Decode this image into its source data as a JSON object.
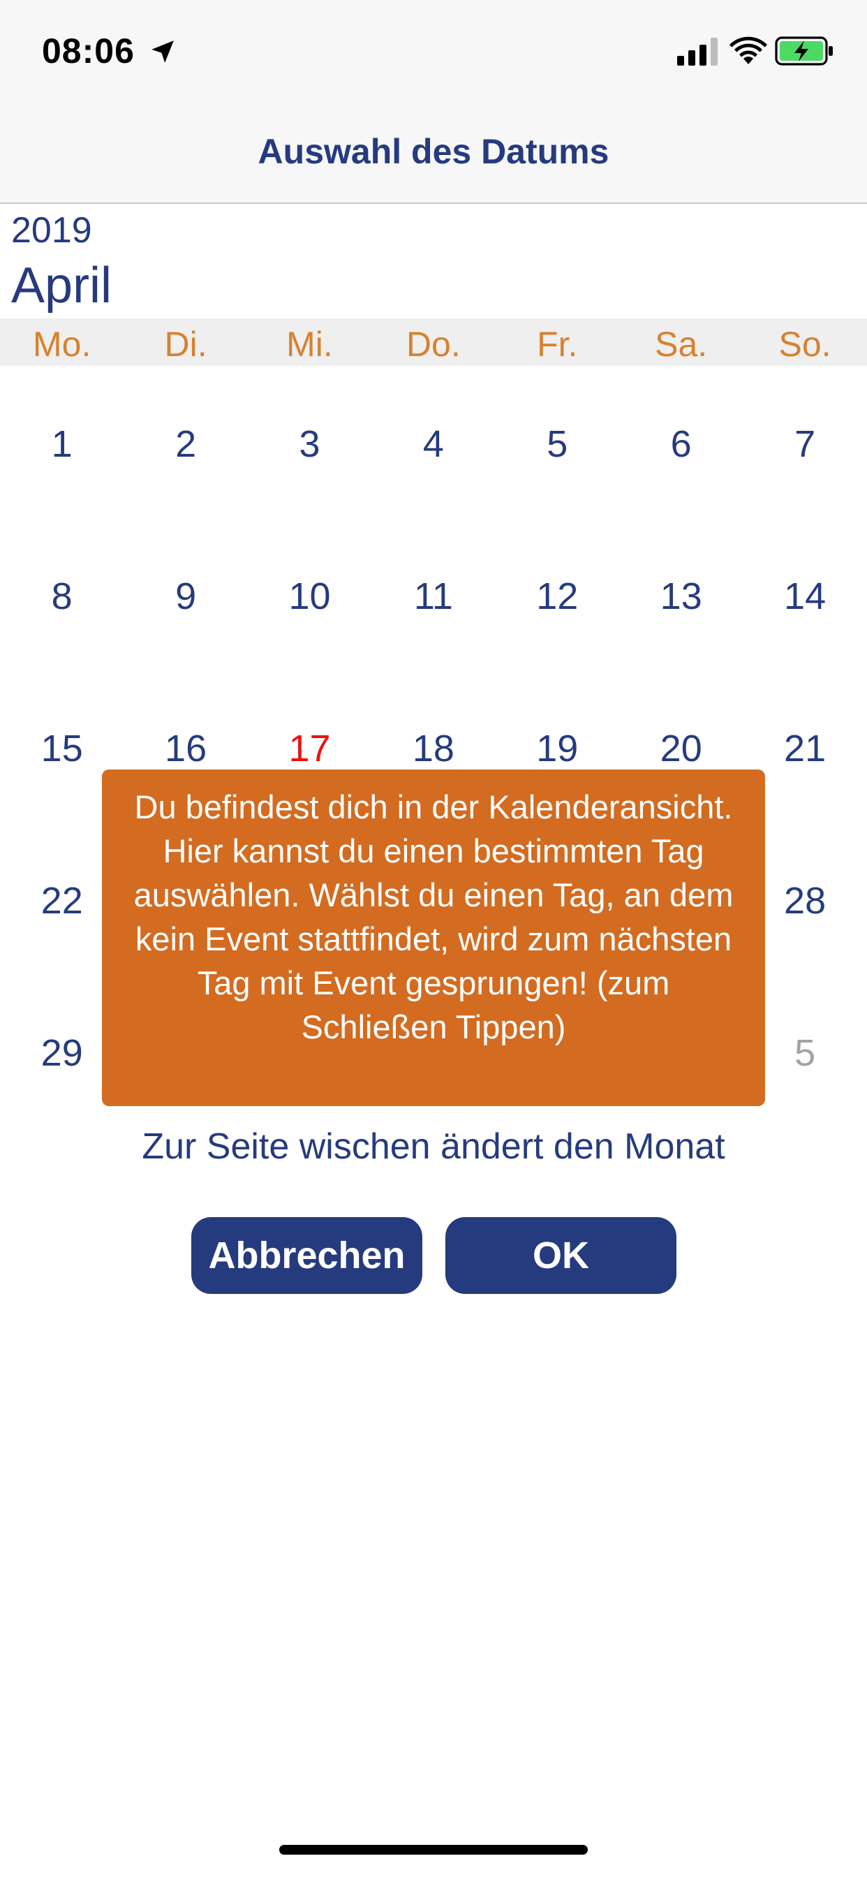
{
  "status_bar": {
    "time": "08:06"
  },
  "header": {
    "title": "Auswahl des Datums"
  },
  "calendar": {
    "year": "2019",
    "month": "April",
    "weekdays": [
      "Mo.",
      "Di.",
      "Mi.",
      "Do.",
      "Fr.",
      "Sa.",
      "So."
    ],
    "weeks": [
      [
        "1",
        "2",
        "3",
        "4",
        "5",
        "6",
        "7"
      ],
      [
        "8",
        "9",
        "10",
        "11",
        "12",
        "13",
        "14"
      ],
      [
        "15",
        "16",
        "17",
        "18",
        "19",
        "20",
        "21"
      ],
      [
        "22",
        "28"
      ],
      [
        "29",
        "5"
      ]
    ],
    "today": "17"
  },
  "tooltip": {
    "text": "Du befindest dich in der Kalenderansicht. Hier kannst du einen bestimmten Tag auswählen. Wählst du einen Tag, an dem kein Event stattfindet, wird zum nächsten Tag mit Event gesprungen! (zum Schließen Tippen)"
  },
  "hint": "Zur Seite wischen ändert den Monat",
  "buttons": {
    "cancel": "Abbrechen",
    "ok": "OK"
  },
  "colors": {
    "primary": "#263b7e",
    "accent": "#d6822f",
    "tooltip": "#d36b20",
    "today": "#ee1111",
    "muted": "#a3a3a3",
    "battery": "#4cd964"
  },
  "icons": [
    "location-arrow-icon",
    "cellular-signal-icon",
    "wifi-icon",
    "battery-charging-icon"
  ]
}
